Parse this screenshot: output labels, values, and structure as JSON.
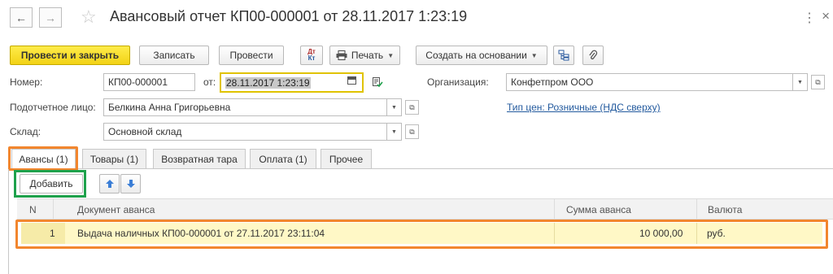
{
  "header": {
    "title": "Авансовый отчет КП00-000001 от 28.11.2017 1:23:19",
    "back": "←",
    "forward": "→",
    "star": "☆",
    "more": "⋮",
    "close": "×"
  },
  "toolbar": {
    "post_close_label": "Провести и закрыть",
    "save_label": "Записать",
    "post_label": "Провести",
    "dtkt_top": "Дт",
    "dtkt_bottom": "Кт",
    "print_label": "Печать",
    "create_based_label": "Создать на основании"
  },
  "form": {
    "number_label": "Номер:",
    "number_value": "КП00-000001",
    "date_label": "от:",
    "date_value": "28.11.2017  1:23:19",
    "org_label": "Организация:",
    "org_value": "Конфетпром ООО",
    "person_label": "Подотчетное лицо:",
    "person_value": "Белкина Анна Григорьевна",
    "price_type_link": "Тип цен: Розничные (НДС сверху)",
    "warehouse_label": "Склад:",
    "warehouse_value": "Основной склад"
  },
  "tabs": [
    {
      "label": "Авансы (1)"
    },
    {
      "label": "Товары (1)"
    },
    {
      "label": "Возвратная тара"
    },
    {
      "label": "Оплата (1)"
    },
    {
      "label": "Прочее"
    }
  ],
  "table_toolbar": {
    "add_label": "Добавить"
  },
  "table": {
    "columns": [
      "N",
      "Документ аванса",
      "Сумма аванса",
      "Валюта"
    ],
    "rows": [
      {
        "n": "1",
        "document": "Выдача наличных КП00-000001 от 27.11.2017 23:11:04",
        "amount": "10 000,00",
        "currency": "руб."
      }
    ]
  },
  "colors": {
    "primary_button": "#f2d216",
    "highlight_orange": "#f2862e",
    "highlight_green": "#1ea14b",
    "selected_row": "#fff8c6",
    "date_focus": "#e0c300",
    "link": "#235a9e"
  }
}
